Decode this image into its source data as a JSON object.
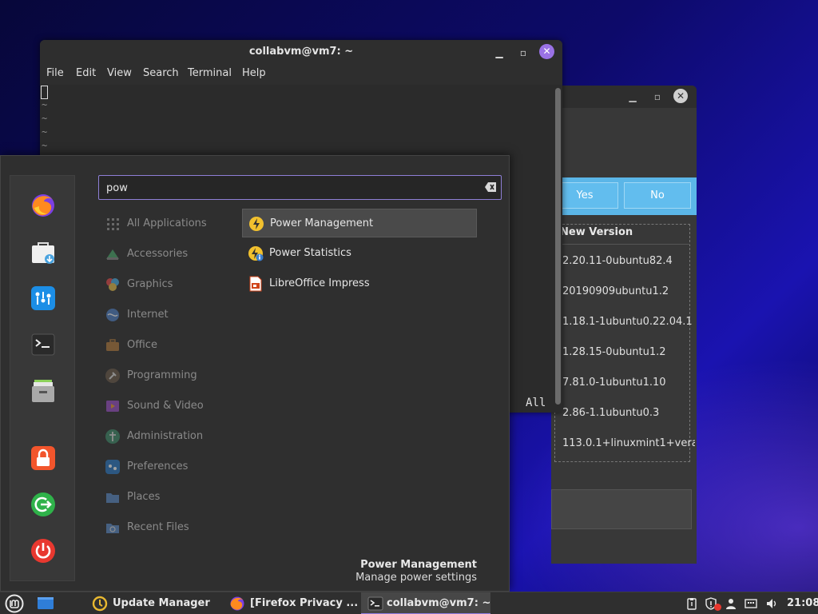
{
  "update_manager": {
    "yes_label": "Yes",
    "no_label": "No",
    "column_new_version": "New Version",
    "versions": [
      "2.20.11-0ubuntu82.4",
      "20190909ubuntu1.2",
      "1.18.1-1ubuntu0.22.04.1",
      "1.28.15-0ubuntu1.2",
      "7.81.0-1ubuntu1.10",
      "2.86-1.1ubuntu0.3",
      "113.0.1+linuxmint1+vera"
    ]
  },
  "terminal": {
    "title": "collabvm@vm7: ~",
    "menu": [
      "File",
      "Edit",
      "View",
      "Search",
      "Terminal",
      "Help"
    ],
    "tilde": "~",
    "status_text": "All"
  },
  "menu": {
    "search_value": "pow",
    "categories": [
      "All Applications",
      "Accessories",
      "Graphics",
      "Internet",
      "Office",
      "Programming",
      "Sound & Video",
      "Administration",
      "Preferences",
      "Places",
      "Recent Files"
    ],
    "results": [
      "Power Management",
      "Power Statistics",
      "LibreOffice Impress"
    ],
    "description_title": "Power Management",
    "description_text": "Manage power settings",
    "favorites": [
      "firefox-icon",
      "software-manager-icon",
      "settings-icon",
      "terminal-icon",
      "files-icon",
      "lock-icon",
      "logout-icon",
      "power-icon"
    ]
  },
  "taskbar": {
    "items": [
      "Update Manager",
      "[Firefox Privacy ...",
      "collabvm@vm7: ~"
    ],
    "clock": "21:08"
  },
  "colors": {
    "accent": "#8e7fd6",
    "close_button": "#9a72e6",
    "update_bar": "#5bb6e8"
  }
}
